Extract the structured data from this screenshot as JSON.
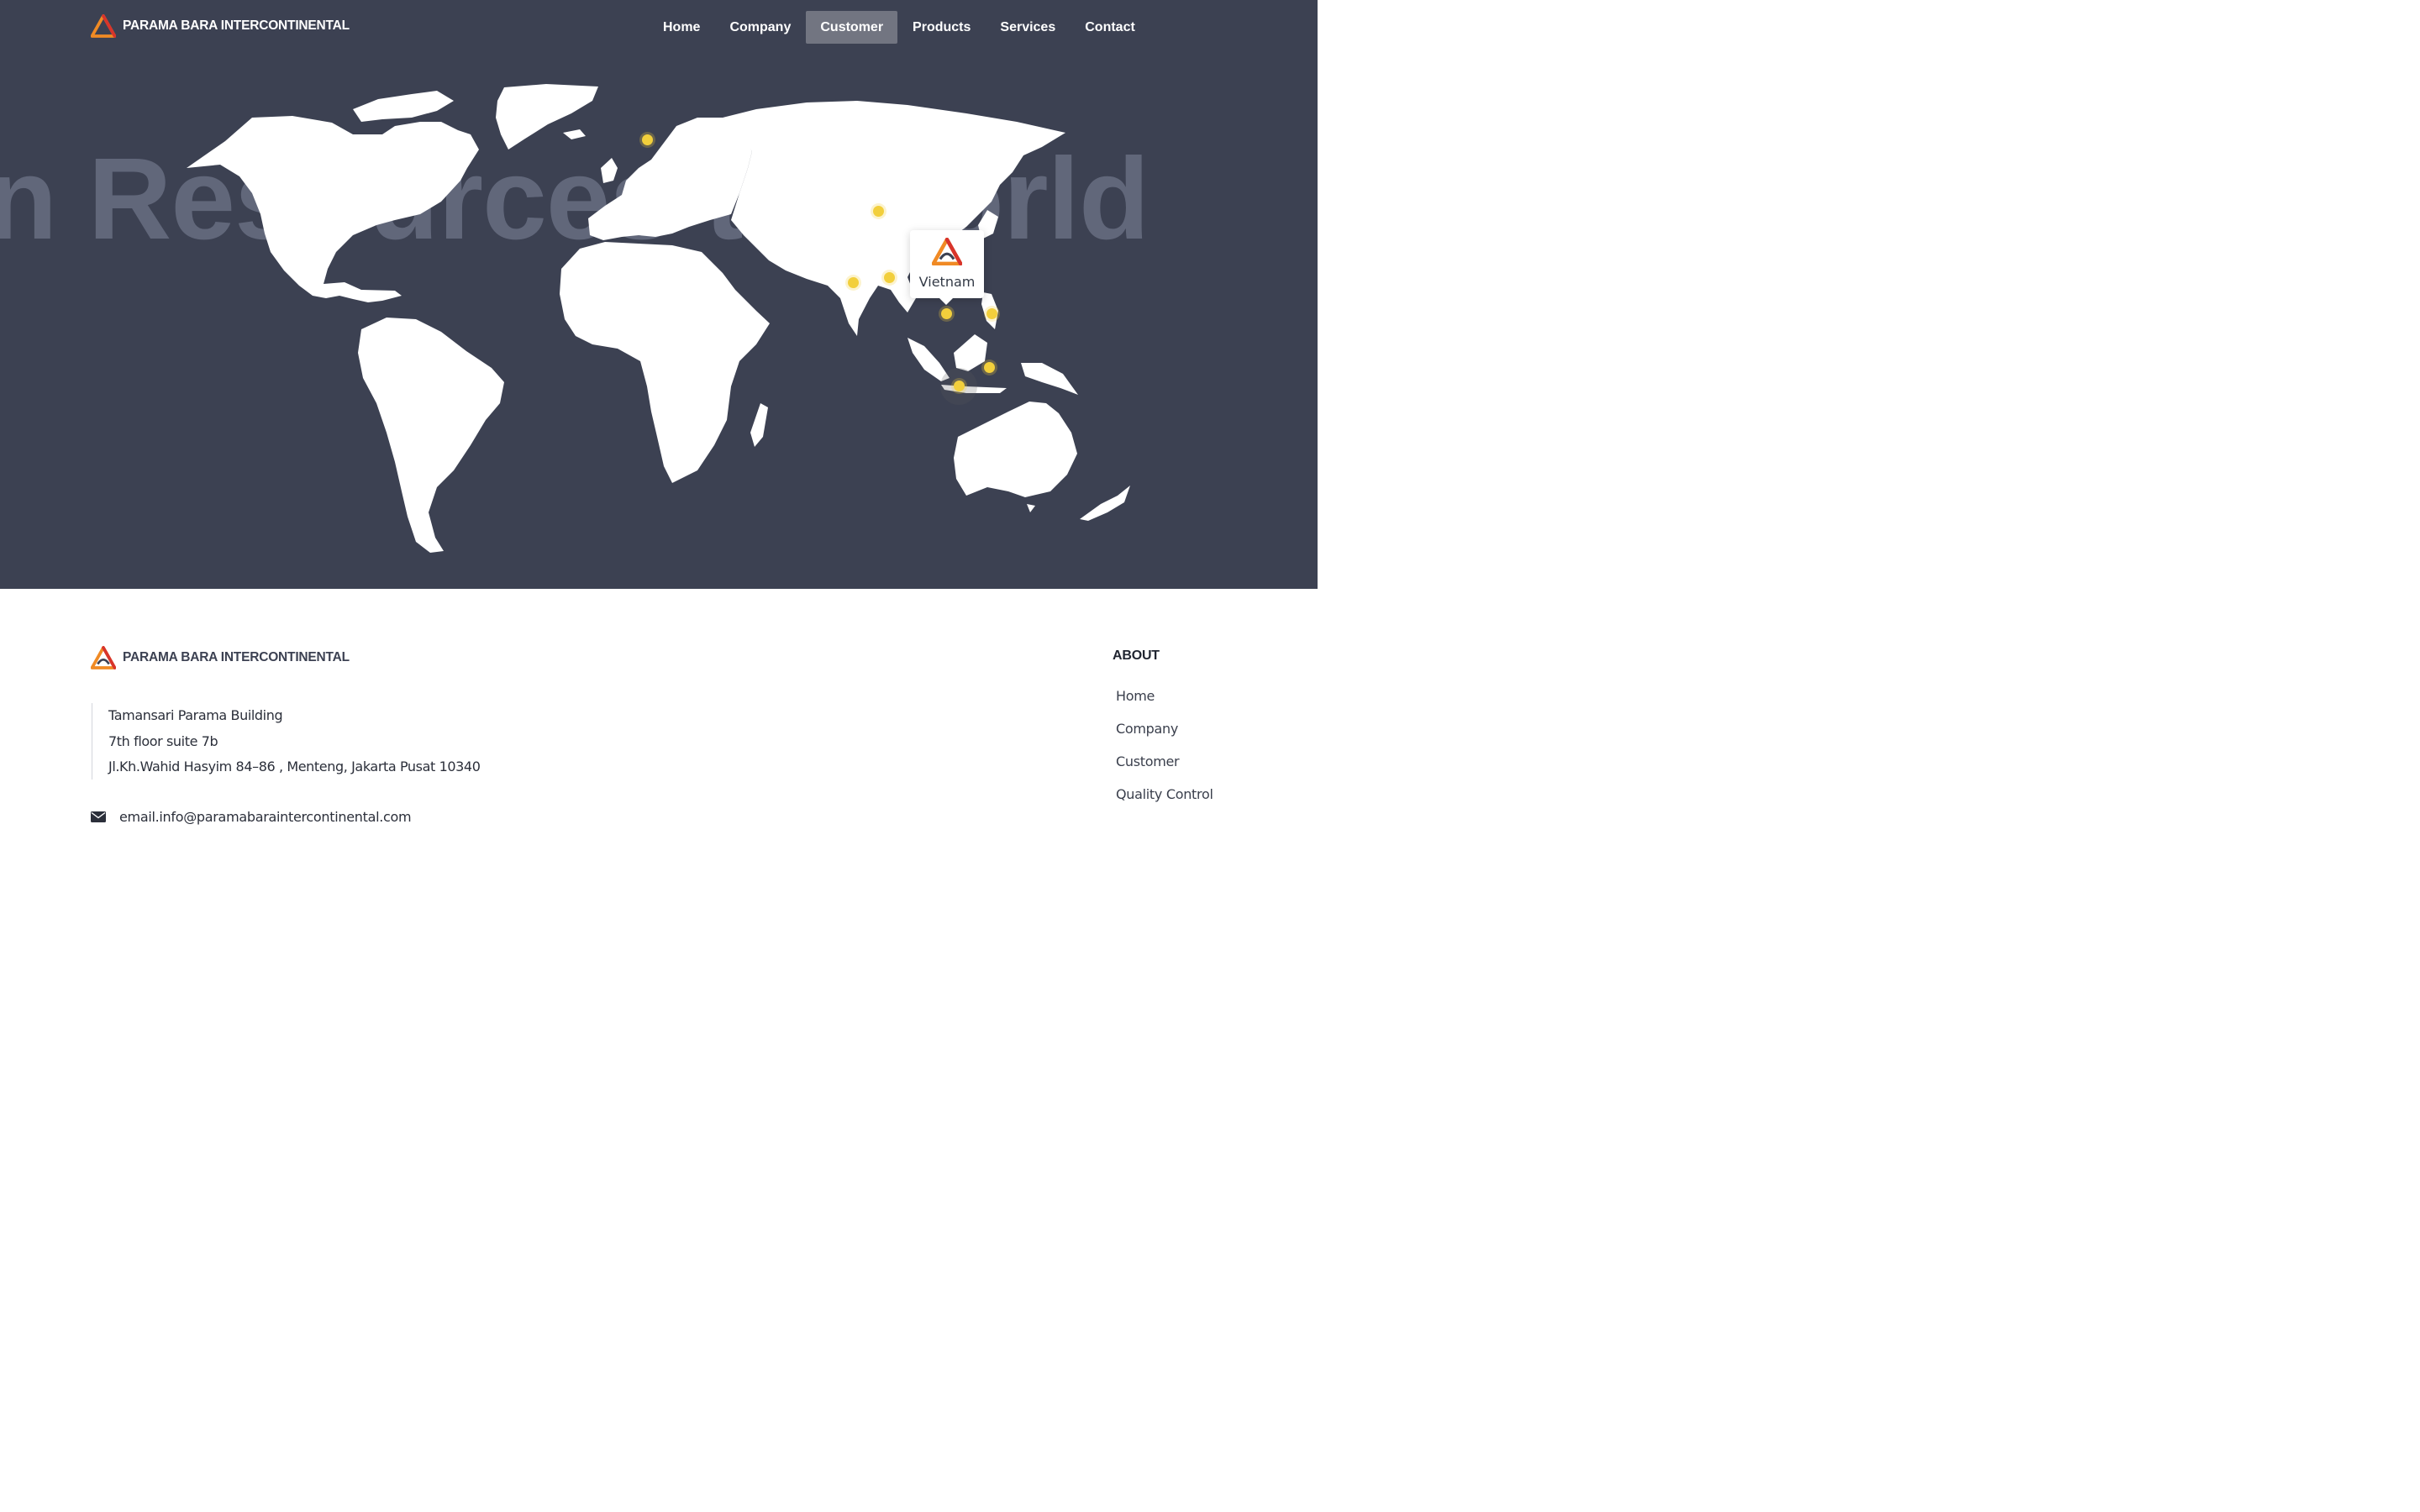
{
  "brand": {
    "name": "PARAMA BARA INTERCONTINENTAL"
  },
  "nav": {
    "items": [
      {
        "label": "Home"
      },
      {
        "label": "Company"
      },
      {
        "label": "Customer",
        "active": true
      },
      {
        "label": "Products"
      },
      {
        "label": "Services"
      },
      {
        "label": "Contact"
      }
    ]
  },
  "hero": {
    "background_text": "n Resources to world",
    "tooltip": {
      "label": "Vietnam"
    }
  },
  "footer": {
    "address": {
      "line1": "Tamansari Parama Building",
      "line2": "7th floor suite 7b",
      "line3": "Jl.Kh.Wahid Hasyim 84–86 , Menteng, Jakarta Pusat 10340"
    },
    "email": "email.info@paramabaraintercontinental.com",
    "about": {
      "heading": "ABOUT",
      "links": [
        "Home",
        "Company",
        "Customer",
        "Quality Control"
      ]
    }
  },
  "colors": {
    "hero_bg": "#3c4152",
    "marker": "#f2cf3c",
    "nav_active": "#727581",
    "logo_orange": "#f08a24",
    "logo_red": "#d8342b"
  },
  "icons": [
    "logo-mark-icon",
    "envelope-icon"
  ]
}
